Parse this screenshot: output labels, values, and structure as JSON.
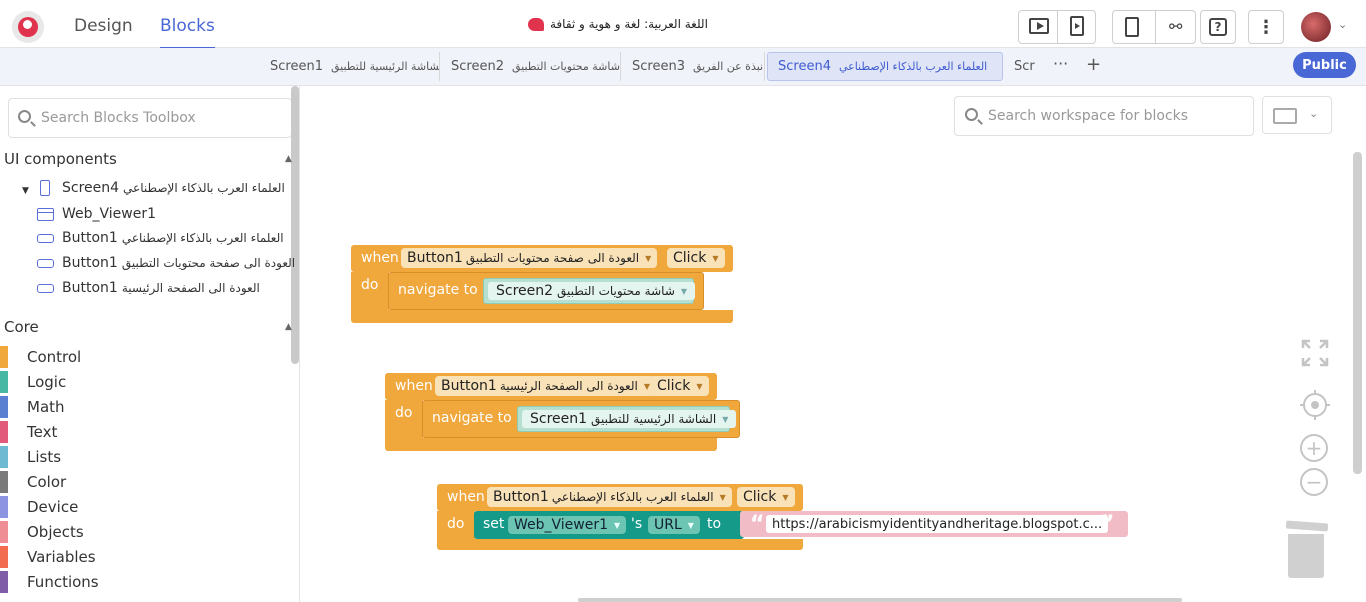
{
  "nav": {
    "design": "Design",
    "blocks": "Blocks"
  },
  "project": {
    "title": "اللغة العربية: لغة و هوية و ثقافة"
  },
  "toolbar": {
    "preview_icon": "play-screen-icon",
    "phone_preview_icon": "phone-preview-icon",
    "export_icon": "export-icon",
    "share_icon": "share-icon",
    "help_label": "?",
    "more_label": "⋮"
  },
  "tabs": [
    {
      "id": "Screen1",
      "ar": "الشاشة الرئيسية للتطبيق"
    },
    {
      "id": "Screen2",
      "ar": "شاشة محتويات التطبيق"
    },
    {
      "id": "Screen3",
      "ar": "نبذة عن الفريق"
    },
    {
      "id": "Screen4",
      "ar": "العلماء العرب بالذكاء الإصطناعي"
    },
    {
      "id": "Scr",
      "ar": ""
    }
  ],
  "tab_more": "···",
  "tab_add": "+",
  "public_label": "Public",
  "sidebar": {
    "search_placeholder": "Search Blocks Toolbox",
    "ui_components_label": "UI components",
    "core_label": "Core",
    "tree": {
      "screen": {
        "name": "Screen4",
        "ar": "العلماء العرب بالذكاء الإصطناعي"
      },
      "web_viewer": "Web_Viewer1",
      "buttons": [
        {
          "name": "Button1",
          "ar": "العلماء العرب بالذكاء الإصطناعي"
        },
        {
          "name": "Button1",
          "ar": "العودة الى صفحة محتويات التطبيق"
        },
        {
          "name": "Button1",
          "ar": "العودة الى الصفحة الرئيسية"
        }
      ]
    },
    "core": [
      {
        "label": "Control",
        "color": "#f0a73c"
      },
      {
        "label": "Logic",
        "color": "#46b8a3"
      },
      {
        "label": "Math",
        "color": "#5b80d1"
      },
      {
        "label": "Text",
        "color": "#e35b7a"
      },
      {
        "label": "Lists",
        "color": "#6dbad2"
      },
      {
        "label": "Color",
        "color": "#7a7a7a"
      },
      {
        "label": "Device",
        "color": "#8d95e3"
      },
      {
        "label": "Objects",
        "color": "#f08e96"
      },
      {
        "label": "Variables",
        "color": "#f26c4f"
      },
      {
        "label": "Functions",
        "color": "#7f5ea7"
      }
    ]
  },
  "workspace": {
    "search_placeholder": "Search workspace for blocks",
    "blocks": {
      "b1": {
        "when": "when",
        "do": "do",
        "component": "Button1",
        "component_ar": "العودة الى صفحة محتويات التطبيق",
        "event": "Click",
        "action": "navigate to",
        "screen": "Screen2",
        "screen_ar": "شاشة محتويات التطبيق"
      },
      "b2": {
        "when": "when",
        "do": "do",
        "component": "Button1",
        "component_ar": "العودة الى الصفحة الرئيسية",
        "event": "Click",
        "action": "navigate to",
        "screen": "Screen1",
        "screen_ar": "الشاشة الرئيسية للتطبيق"
      },
      "b3": {
        "when": "when",
        "do": "do",
        "component": "Button1",
        "component_ar": "العلماء العرب بالذكاء الإصطناعي",
        "event": "Click",
        "set": "set",
        "target": "Web_Viewer1",
        "possessive": "'s",
        "property": "URL",
        "to": "to",
        "url": "https://arabicismyidentityandheritage.blogspot.c..."
      }
    }
  },
  "colors": {
    "accent": "#4a67d6",
    "event_block": "#f0a73c",
    "component_block": "#159a8a",
    "text_block": "#f2bcc7"
  }
}
